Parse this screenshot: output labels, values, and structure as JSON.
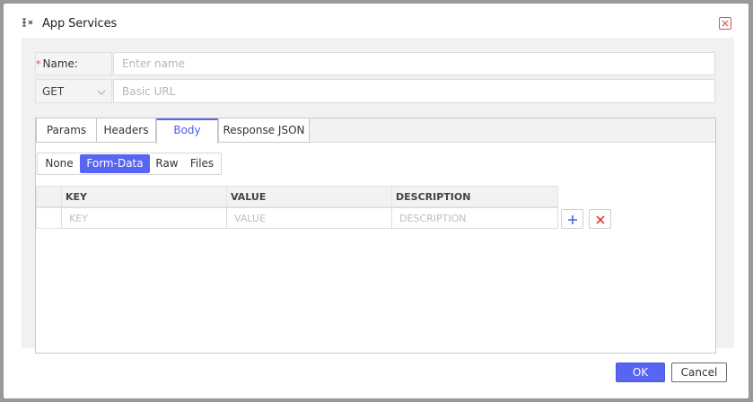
{
  "dialog": {
    "title": "App Services",
    "title_icon": "sidebar-collapse-icon",
    "close_icon": "close-icon"
  },
  "form": {
    "name_required_mark": "*",
    "name_label": "Name:",
    "name_placeholder": "Enter name",
    "name_value": "",
    "method_value": "GET",
    "url_placeholder": "Basic URL",
    "url_value": ""
  },
  "tabs": [
    {
      "label": "Params",
      "active": false
    },
    {
      "label": "Headers",
      "active": false
    },
    {
      "label": "Body",
      "active": true
    },
    {
      "label": "Response JSON",
      "active": false
    }
  ],
  "body_types": [
    {
      "label": "None",
      "active": false
    },
    {
      "label": "Form-Data",
      "active": true
    },
    {
      "label": "Raw",
      "active": false
    },
    {
      "label": "Files",
      "active": false
    }
  ],
  "grid": {
    "columns": [
      "KEY",
      "VALUE",
      "DESCRIPTION"
    ],
    "placeholders": [
      "KEY",
      "VALUE",
      "DESCRIPTION"
    ],
    "add_icon": "plus-icon",
    "delete_icon": "delete-x-icon"
  },
  "footer": {
    "ok_label": "OK",
    "cancel_label": "Cancel"
  },
  "colors": {
    "accent": "#5865f2",
    "danger": "#d9534f"
  }
}
